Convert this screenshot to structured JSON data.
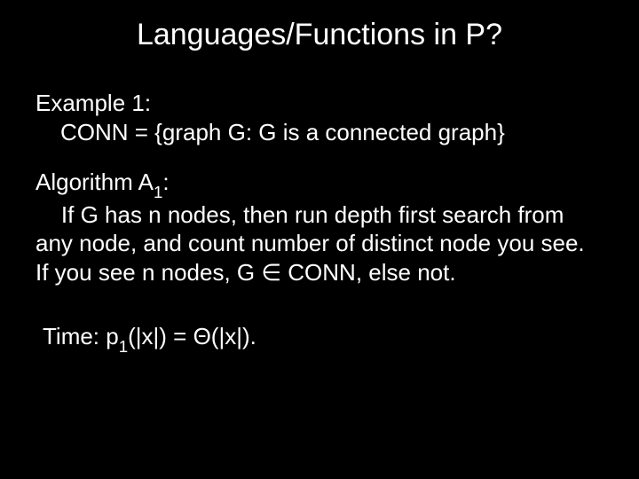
{
  "title": "Languages/Functions in P?",
  "example": {
    "heading": "Example 1:",
    "defn": "CONN = {graph G: G is a connected graph}"
  },
  "algo": {
    "heading_pre": "Algorithm A",
    "heading_sub": "1",
    "heading_post": ":",
    "text_part1": "If G has n nodes, then run depth first search from any node, and count number of distinct node you see. If you see n nodes, G ",
    "elem": "∈",
    "text_part2": " CONN, else not."
  },
  "time": {
    "pre": "Time: p",
    "sub": "1",
    "mid": "(|x|) = Θ(|x|)."
  }
}
